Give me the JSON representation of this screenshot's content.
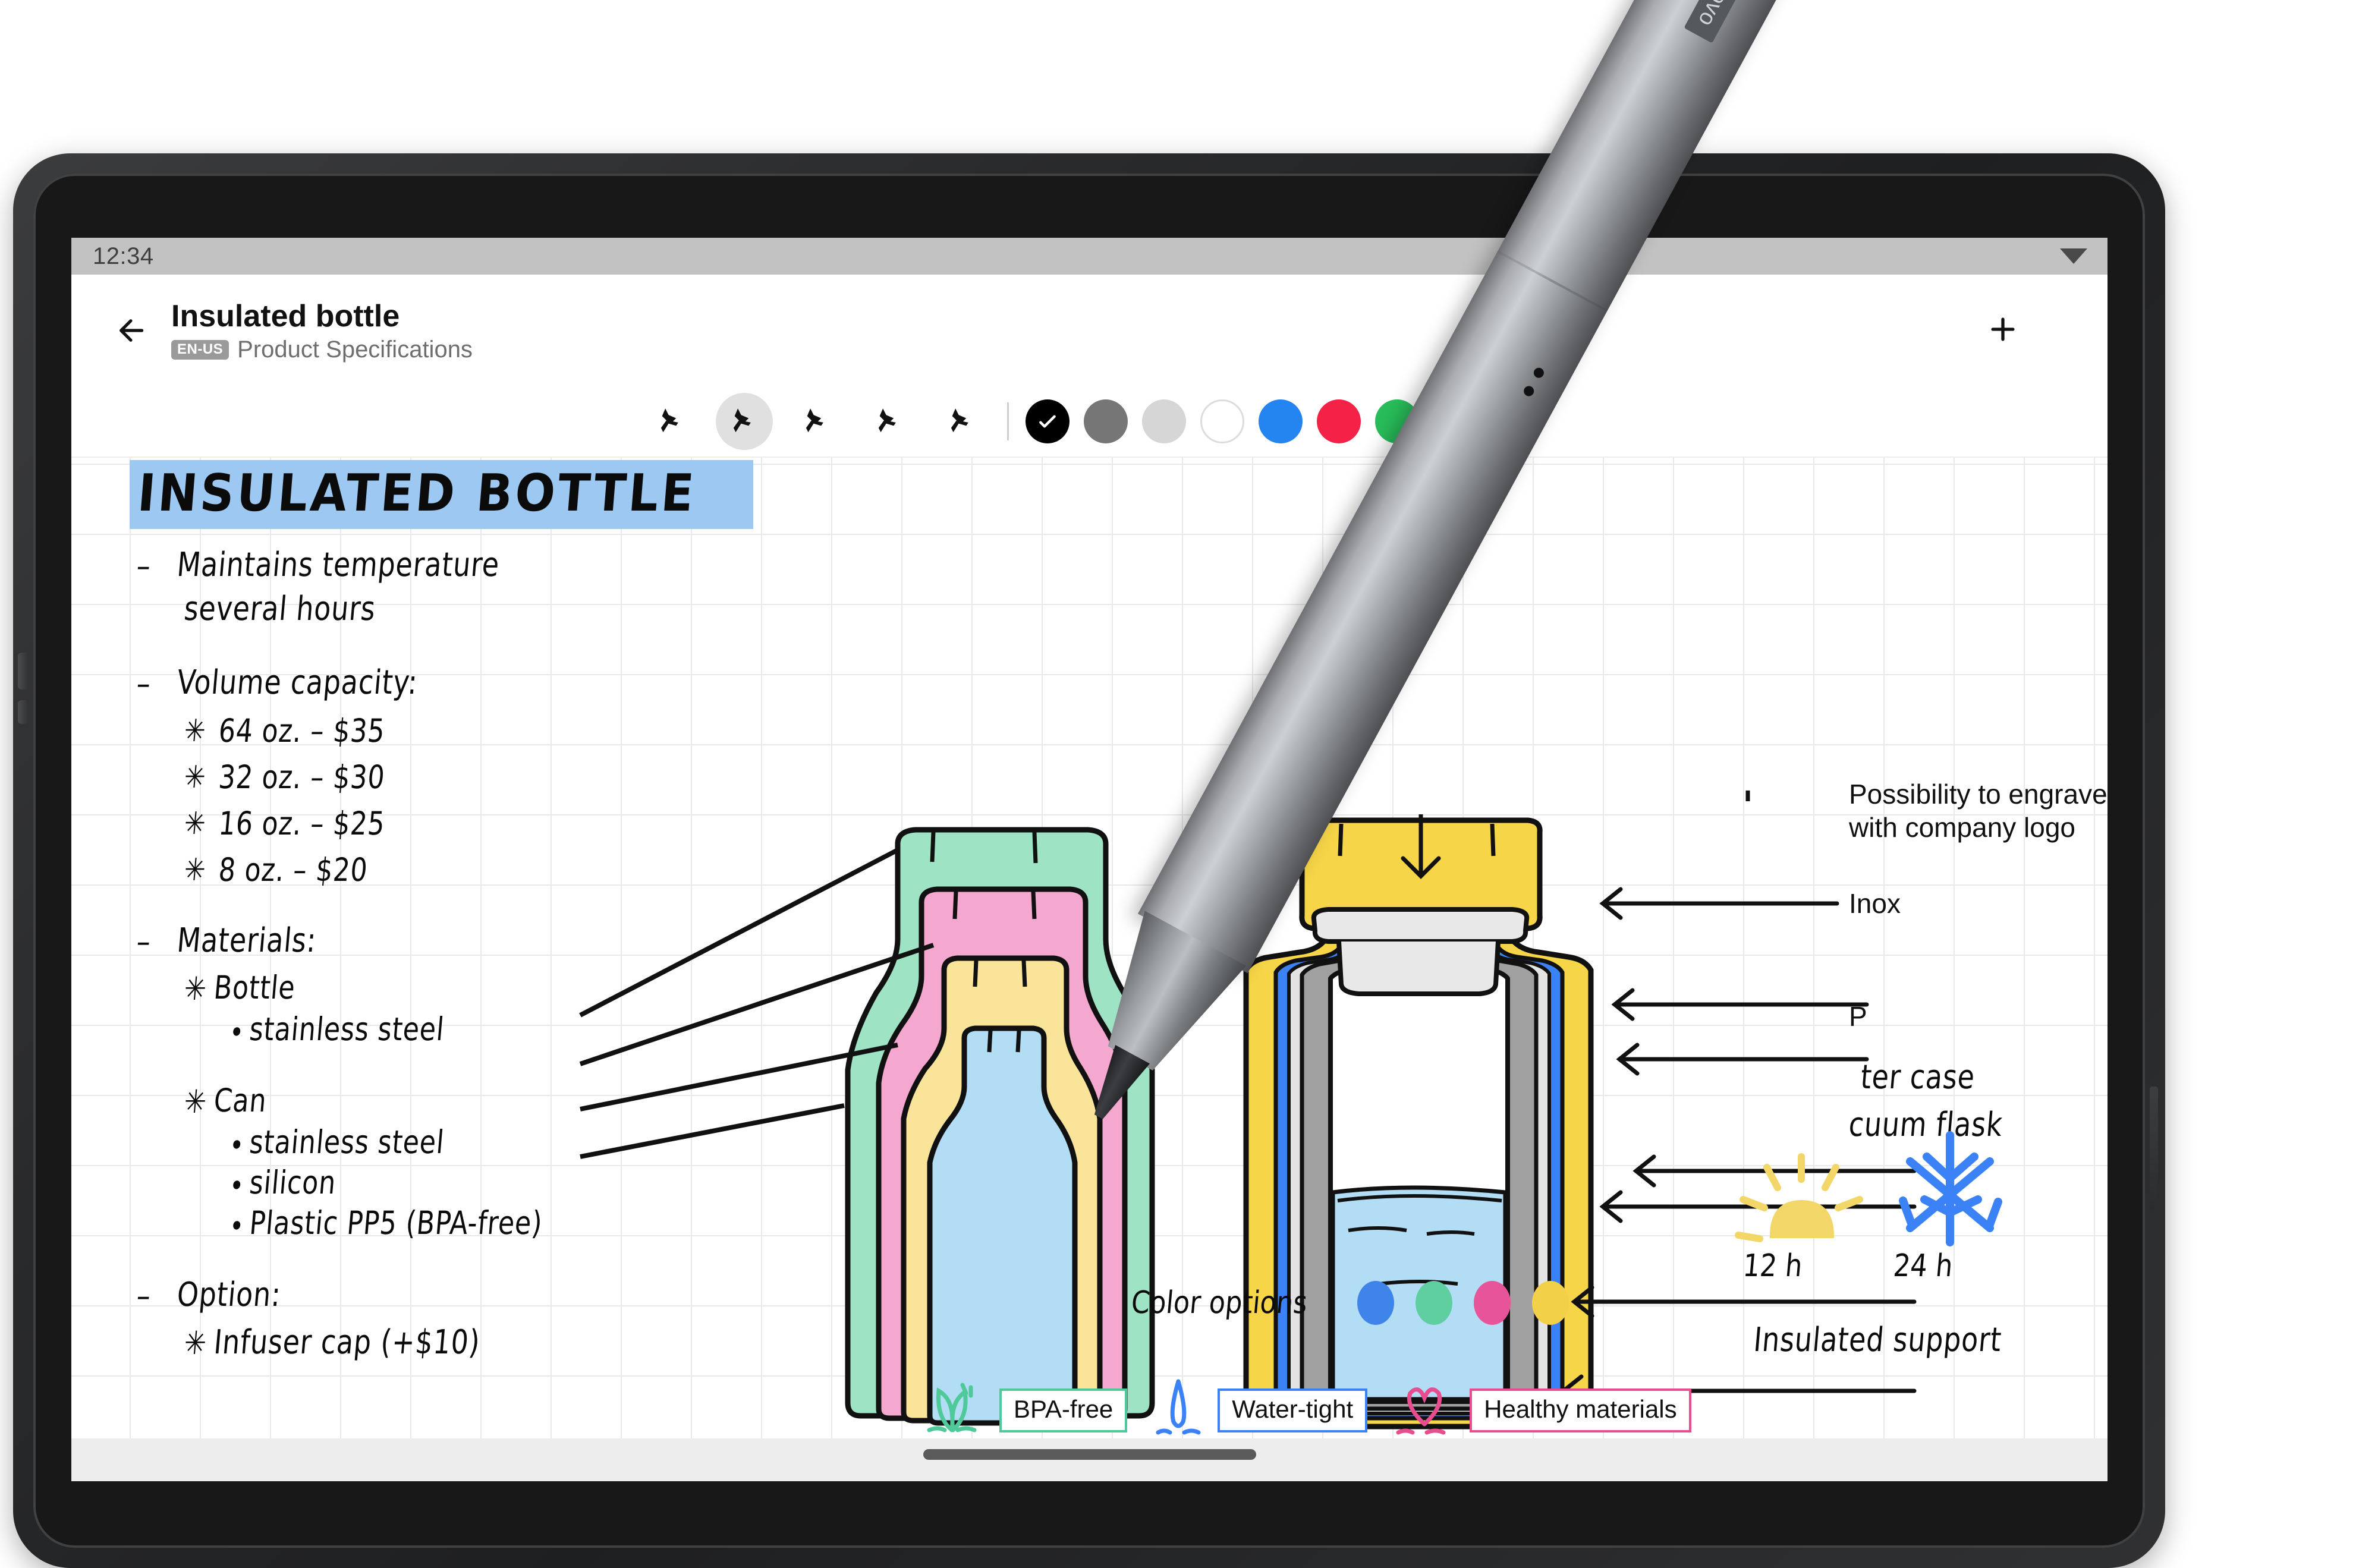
{
  "device": {
    "brand": "Lenovo",
    "stylus_label": "Lenovo"
  },
  "statusbar": {
    "clock": "12:34",
    "wifi_icon": "signal-icon"
  },
  "appbar": {
    "back_icon": "back-arrow-icon",
    "title": "Insulated bottle",
    "language_badge": "EN-US",
    "subtitle": "Product Specifications",
    "add_icon": "plus-icon",
    "add_label": "+"
  },
  "toolbar": {
    "tools": [
      {
        "name": "pen-tool-1",
        "icon": "pen-icon",
        "active": false
      },
      {
        "name": "pen-tool-2",
        "icon": "pen-icon",
        "active": true
      },
      {
        "name": "pen-tool-3",
        "icon": "pen-icon",
        "active": false
      },
      {
        "name": "pen-tool-4",
        "icon": "pen-icon",
        "active": false
      },
      {
        "name": "pen-tool-5",
        "icon": "pen-icon",
        "active": false
      }
    ],
    "swatches": [
      {
        "name": "black",
        "hex": "#000000",
        "selected": true
      },
      {
        "name": "dark-gray",
        "hex": "#767676",
        "selected": false
      },
      {
        "name": "light-gray",
        "hex": "#d6d6d6",
        "selected": false
      },
      {
        "name": "white",
        "hex": "#ffffff",
        "selected": false
      },
      {
        "name": "blue",
        "hex": "#2484f0",
        "selected": false
      },
      {
        "name": "red",
        "hex": "#f42247",
        "selected": false
      },
      {
        "name": "green",
        "hex": "#28bd5a",
        "selected": false
      },
      {
        "name": "yellow",
        "hex": "#fbc92b",
        "selected": false
      }
    ],
    "add_color_icon": "plus-icon",
    "add_color_label": "+"
  },
  "notes": {
    "title": "INSULATED BOTTLE",
    "title_highlight_hex": "#9dc8f2",
    "lines": [
      {
        "marker": "–",
        "text": "Maintains temperature"
      },
      {
        "marker": "",
        "text": "several hours"
      },
      {
        "marker": "–",
        "text": "Volume capacity:"
      },
      {
        "marker": "✳",
        "text": "64 oz. – $35"
      },
      {
        "marker": "✳",
        "text": "32 oz. – $30"
      },
      {
        "marker": "✳",
        "text": "16 oz. – $25"
      },
      {
        "marker": "✳",
        "text": "8 oz. – $20"
      },
      {
        "marker": "–",
        "text": "Materials:"
      },
      {
        "marker": "✳",
        "text": "Bottle"
      },
      {
        "marker": "•",
        "text": "stainless steel"
      },
      {
        "marker": "✳",
        "text": "Can"
      },
      {
        "marker": "•",
        "text": "stainless steel"
      },
      {
        "marker": "•",
        "text": "silicon"
      },
      {
        "marker": "•",
        "text": "Plastic PP5 (BPA-free)"
      },
      {
        "marker": "–",
        "text": "Option:"
      },
      {
        "marker": "✳",
        "text": "Infuser cap (+$10)"
      }
    ]
  },
  "annotations": {
    "engrave": "Possibility to engrave\nwith company logo",
    "inox": "Inox",
    "plastic": "P",
    "outer_case": "ter case",
    "vacuum_flask": "cuum flask",
    "insulated_support": "Insulated support",
    "hours_12": "12 h",
    "hours_24": "24 h"
  },
  "color_options": {
    "label": "Color options",
    "dots": [
      {
        "name": "blue",
        "hex": "#3f84e8"
      },
      {
        "name": "green",
        "hex": "#5fcfa1"
      },
      {
        "name": "pink",
        "hex": "#e8549a"
      },
      {
        "name": "yellow",
        "hex": "#f2d149"
      }
    ]
  },
  "badges": [
    {
      "icon": "leaf-icon",
      "icon_hex": "#4fc89a",
      "label": "BPA-free",
      "border_hex": "#4fc89a"
    },
    {
      "icon": "droplet-icon",
      "icon_hex": "#3b82f6",
      "label": "Water-tight",
      "border_hex": "#3b82f6"
    },
    {
      "icon": "heart-icon",
      "icon_hex": "#e84d8f",
      "label": "Healthy materials",
      "border_hex": "#e84d8f"
    }
  ],
  "sketch": {
    "stacked_bottle_colors": [
      "#9fe3c5",
      "#f5a8cf",
      "#fae49a",
      "#b3ddf5"
    ],
    "cross_section_colors": {
      "cap": "#f7d548",
      "outer": "#f7d548",
      "steel": "#a0a0a0",
      "blue_layer": "#3b82f6",
      "inner_light": "#e3e3e3",
      "water": "#b3ddf5"
    }
  },
  "navbar": {
    "home_pill": "home-indicator"
  }
}
